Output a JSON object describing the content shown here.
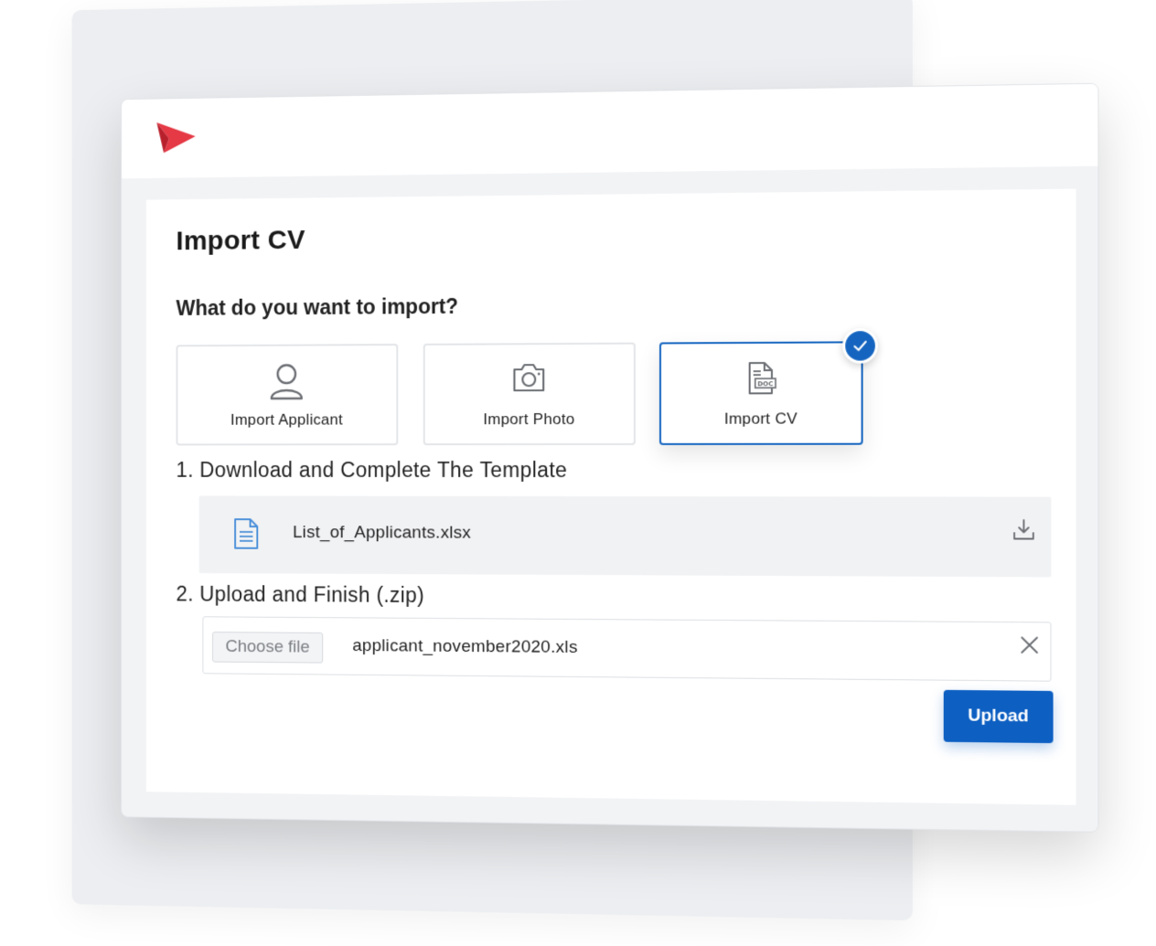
{
  "dialog": {
    "title": "Import CV",
    "question": "What do you want to import?"
  },
  "options": [
    {
      "label": "Import Applicant",
      "icon": "user-icon",
      "selected": false
    },
    {
      "label": "Import Photo",
      "icon": "camera-icon",
      "selected": false
    },
    {
      "label": "Import CV",
      "icon": "doc-file-icon",
      "selected": true
    }
  ],
  "steps": {
    "download": {
      "title": "1. Download and Complete The Template",
      "file_name": "List_of_Applicants.xlsx"
    },
    "upload": {
      "title": "2. Upload and Finish (.zip)",
      "choose_label": "Choose file",
      "chosen_file": "applicant_november2020.xls",
      "button_label": "Upload"
    }
  },
  "colors": {
    "accent": "#1565c0",
    "button": "#0d5fc2",
    "logo": "#e53945"
  }
}
